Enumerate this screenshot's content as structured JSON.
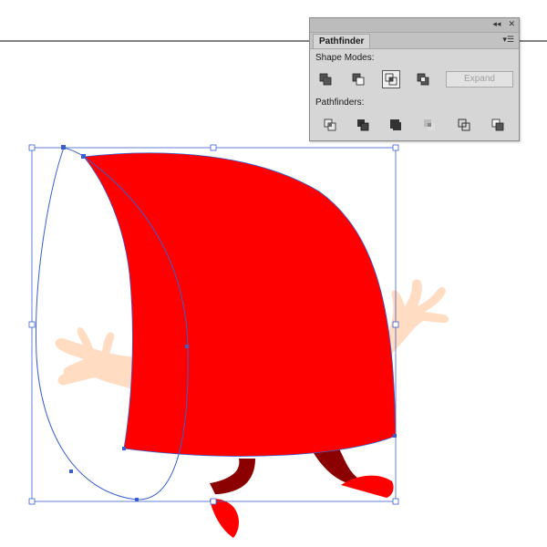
{
  "canvas": {
    "artboard_line_color": "#000000",
    "selection_color": "#3a5fcd",
    "hat_color": "#ff0000",
    "arm_color": "#ffdcc2",
    "leg_color": "#8b0000"
  },
  "panel": {
    "title": "Pathfinder",
    "collapse_icon": "double-chevron-left-icon",
    "close_icon": "close-icon",
    "menu_icon": "panel-menu-icon",
    "shape_modes": {
      "label": "Shape Modes:",
      "buttons": [
        "unite-icon",
        "minus-front-icon",
        "intersect-icon",
        "exclude-icon"
      ],
      "active": "intersect-icon",
      "expand_label": "Expand"
    },
    "pathfinders": {
      "label": "Pathfinders:",
      "buttons": [
        "divide-icon",
        "trim-icon",
        "merge-icon",
        "crop-icon",
        "outline-icon",
        "minus-back-icon"
      ]
    }
  }
}
